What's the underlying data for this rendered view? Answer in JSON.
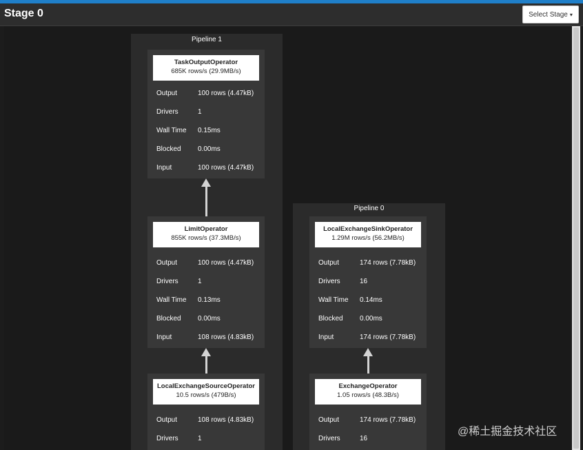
{
  "header": {
    "title": "Stage 0",
    "select_label": "Select Stage",
    "caret": "▾"
  },
  "pipelines": [
    {
      "title": "Pipeline 1",
      "operators": [
        {
          "name": "TaskOutputOperator",
          "rate": "685K rows/s (29.9MB/s)",
          "stats": [
            {
              "label": "Output",
              "value": "100 rows (4.47kB)"
            },
            {
              "label": "Drivers",
              "value": "1"
            },
            {
              "label": "Wall Time",
              "value": "0.15ms"
            },
            {
              "label": "Blocked",
              "value": "0.00ms"
            },
            {
              "label": "Input",
              "value": "100 rows (4.47kB)"
            }
          ]
        },
        {
          "name": "LimitOperator",
          "rate": "855K rows/s (37.3MB/s)",
          "stats": [
            {
              "label": "Output",
              "value": "100 rows (4.47kB)"
            },
            {
              "label": "Drivers",
              "value": "1"
            },
            {
              "label": "Wall Time",
              "value": "0.13ms"
            },
            {
              "label": "Blocked",
              "value": "0.00ms"
            },
            {
              "label": "Input",
              "value": "108 rows (4.83kB)"
            }
          ]
        },
        {
          "name": "LocalExchangeSourceOperator",
          "rate": "10.5 rows/s (479B/s)",
          "stats": [
            {
              "label": "Output",
              "value": "108 rows (4.83kB)"
            },
            {
              "label": "Drivers",
              "value": "1"
            }
          ]
        }
      ]
    },
    {
      "title": "Pipeline 0",
      "operators": [
        {
          "name": "LocalExchangeSinkOperator",
          "rate": "1.29M rows/s (56.2MB/s)",
          "stats": [
            {
              "label": "Output",
              "value": "174 rows (7.78kB)"
            },
            {
              "label": "Drivers",
              "value": "16"
            },
            {
              "label": "Wall Time",
              "value": "0.14ms"
            },
            {
              "label": "Blocked",
              "value": "0.00ms"
            },
            {
              "label": "Input",
              "value": "174 rows (7.78kB)"
            }
          ]
        },
        {
          "name": "ExchangeOperator",
          "rate": "1.05 rows/s (48.3B/s)",
          "stats": [
            {
              "label": "Output",
              "value": "174 rows (7.78kB)"
            },
            {
              "label": "Drivers",
              "value": "16"
            }
          ]
        }
      ]
    }
  ],
  "watermark": "@稀土掘金技术社区"
}
